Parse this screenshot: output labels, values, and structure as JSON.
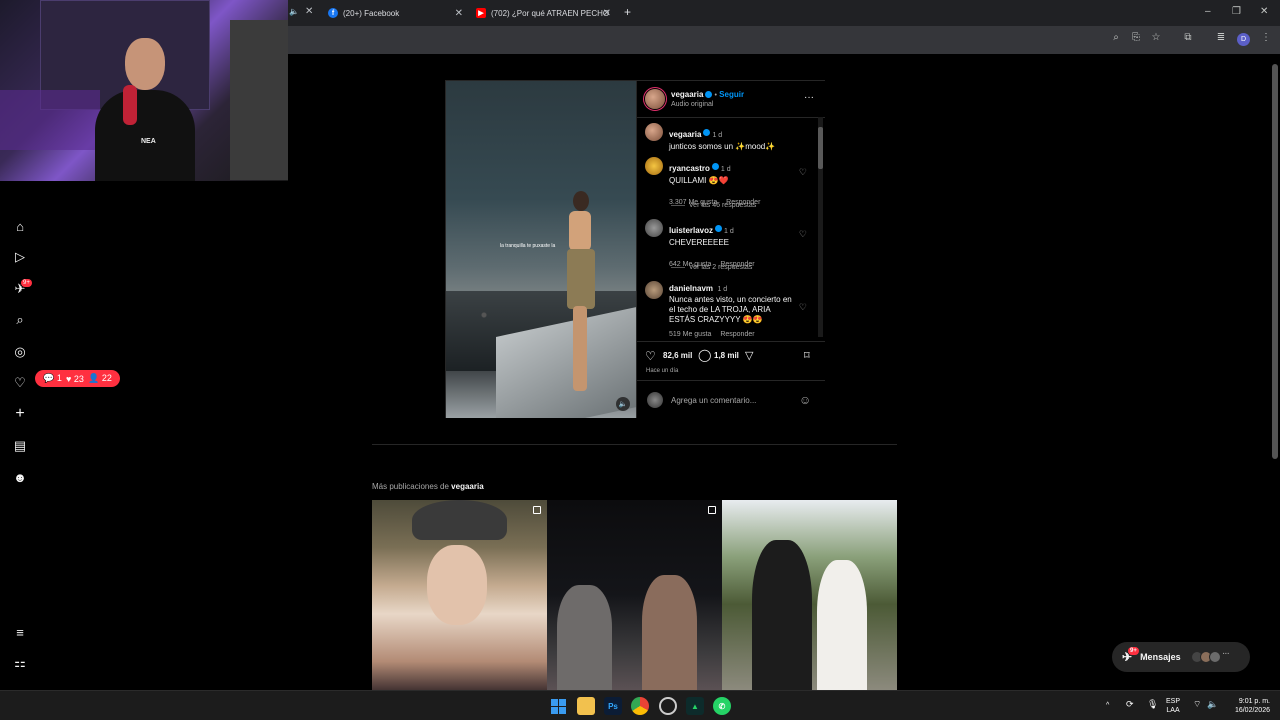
{
  "browser": {
    "tabs": [
      {
        "title": "(20+) Facebook",
        "icon": "facebook-icon",
        "color": "#1877f2"
      },
      {
        "title": "(702) ¿Por qué ATRAEN PECHO",
        "icon": "youtube-icon",
        "color": "#ff0000"
      }
    ],
    "new_tab": "+",
    "window_controls": [
      "–",
      "❐",
      "✕"
    ],
    "profile_initial": "D"
  },
  "webcam": {
    "shirt_text": "NEA"
  },
  "sidebar": {
    "items": [
      {
        "name": "home",
        "icon": "⌂"
      },
      {
        "name": "reels",
        "icon": "▷"
      },
      {
        "name": "messages",
        "icon": "✈",
        "badge": "9+"
      },
      {
        "name": "search",
        "icon": "⌕"
      },
      {
        "name": "explore",
        "icon": "◎"
      },
      {
        "name": "notifications",
        "icon": "♡"
      },
      {
        "name": "create",
        "icon": "+"
      },
      {
        "name": "dashboard",
        "icon": "▤"
      },
      {
        "name": "profile",
        "icon": "☻"
      }
    ],
    "more": "≡",
    "also_from_meta": "⚏",
    "notification_pill": {
      "comments": "1",
      "likes": "23",
      "follows": "22"
    }
  },
  "post": {
    "author": "vegaaria",
    "follow": "Seguir",
    "audio": "Audio original",
    "more": "···",
    "media_caption_overlay": "la tranquilla te puxaste la",
    "caption": {
      "user": "vegaaria",
      "time": "1 d",
      "text": "junticos somos un ✨mood✨"
    },
    "comments": [
      {
        "user": "ryancastro",
        "time": "1 d",
        "text": "QUILLAMI 😍❤️",
        "likes": "3.307 Me gusta",
        "reply": "Responder",
        "view_replies": "Ver las 46 respuestas"
      },
      {
        "user": "luisterlavoz",
        "time": "1 d",
        "text": "CHEVEREEEEE",
        "likes": "642 Me gusta",
        "reply": "Responder",
        "view_replies": "Ver las 2 respuestas"
      },
      {
        "user": "danielnavm",
        "time": "1 d",
        "text": "Nunca antes visto, un concierto en el techo de LA TROJA, ARIA ESTÁS CRAZYYYY 😍😍",
        "likes": "519 Me gusta",
        "reply": "Responder"
      }
    ],
    "like_count": "82,6 mil",
    "comment_count": "1,8 mil",
    "posted": "Hace un día",
    "add_comment_placeholder": "Agrega un comentario..."
  },
  "more_posts": {
    "prefix": "Más publicaciones de",
    "user": "vegaaria"
  },
  "messages_button": {
    "label": "Mensajes",
    "badge": "9+"
  },
  "taskbar": {
    "lang": "ESP",
    "layout": "LAA",
    "time": "9:01 p. m.",
    "date": "16/02/2026"
  }
}
